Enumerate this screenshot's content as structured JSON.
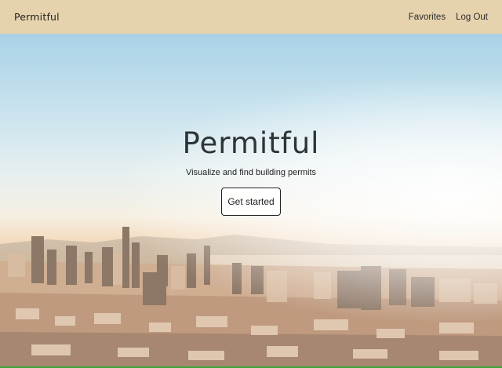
{
  "nav": {
    "brand": "Permitful",
    "links": [
      "Favorites",
      "Log Out"
    ]
  },
  "hero": {
    "title": "Permitful",
    "subtitle": "Visualize and find building permits",
    "cta_label": "Get started"
  },
  "colors": {
    "navbar": "#e6d3ad",
    "title": "#2d3436",
    "bottom_bar": "#3aa83a"
  }
}
